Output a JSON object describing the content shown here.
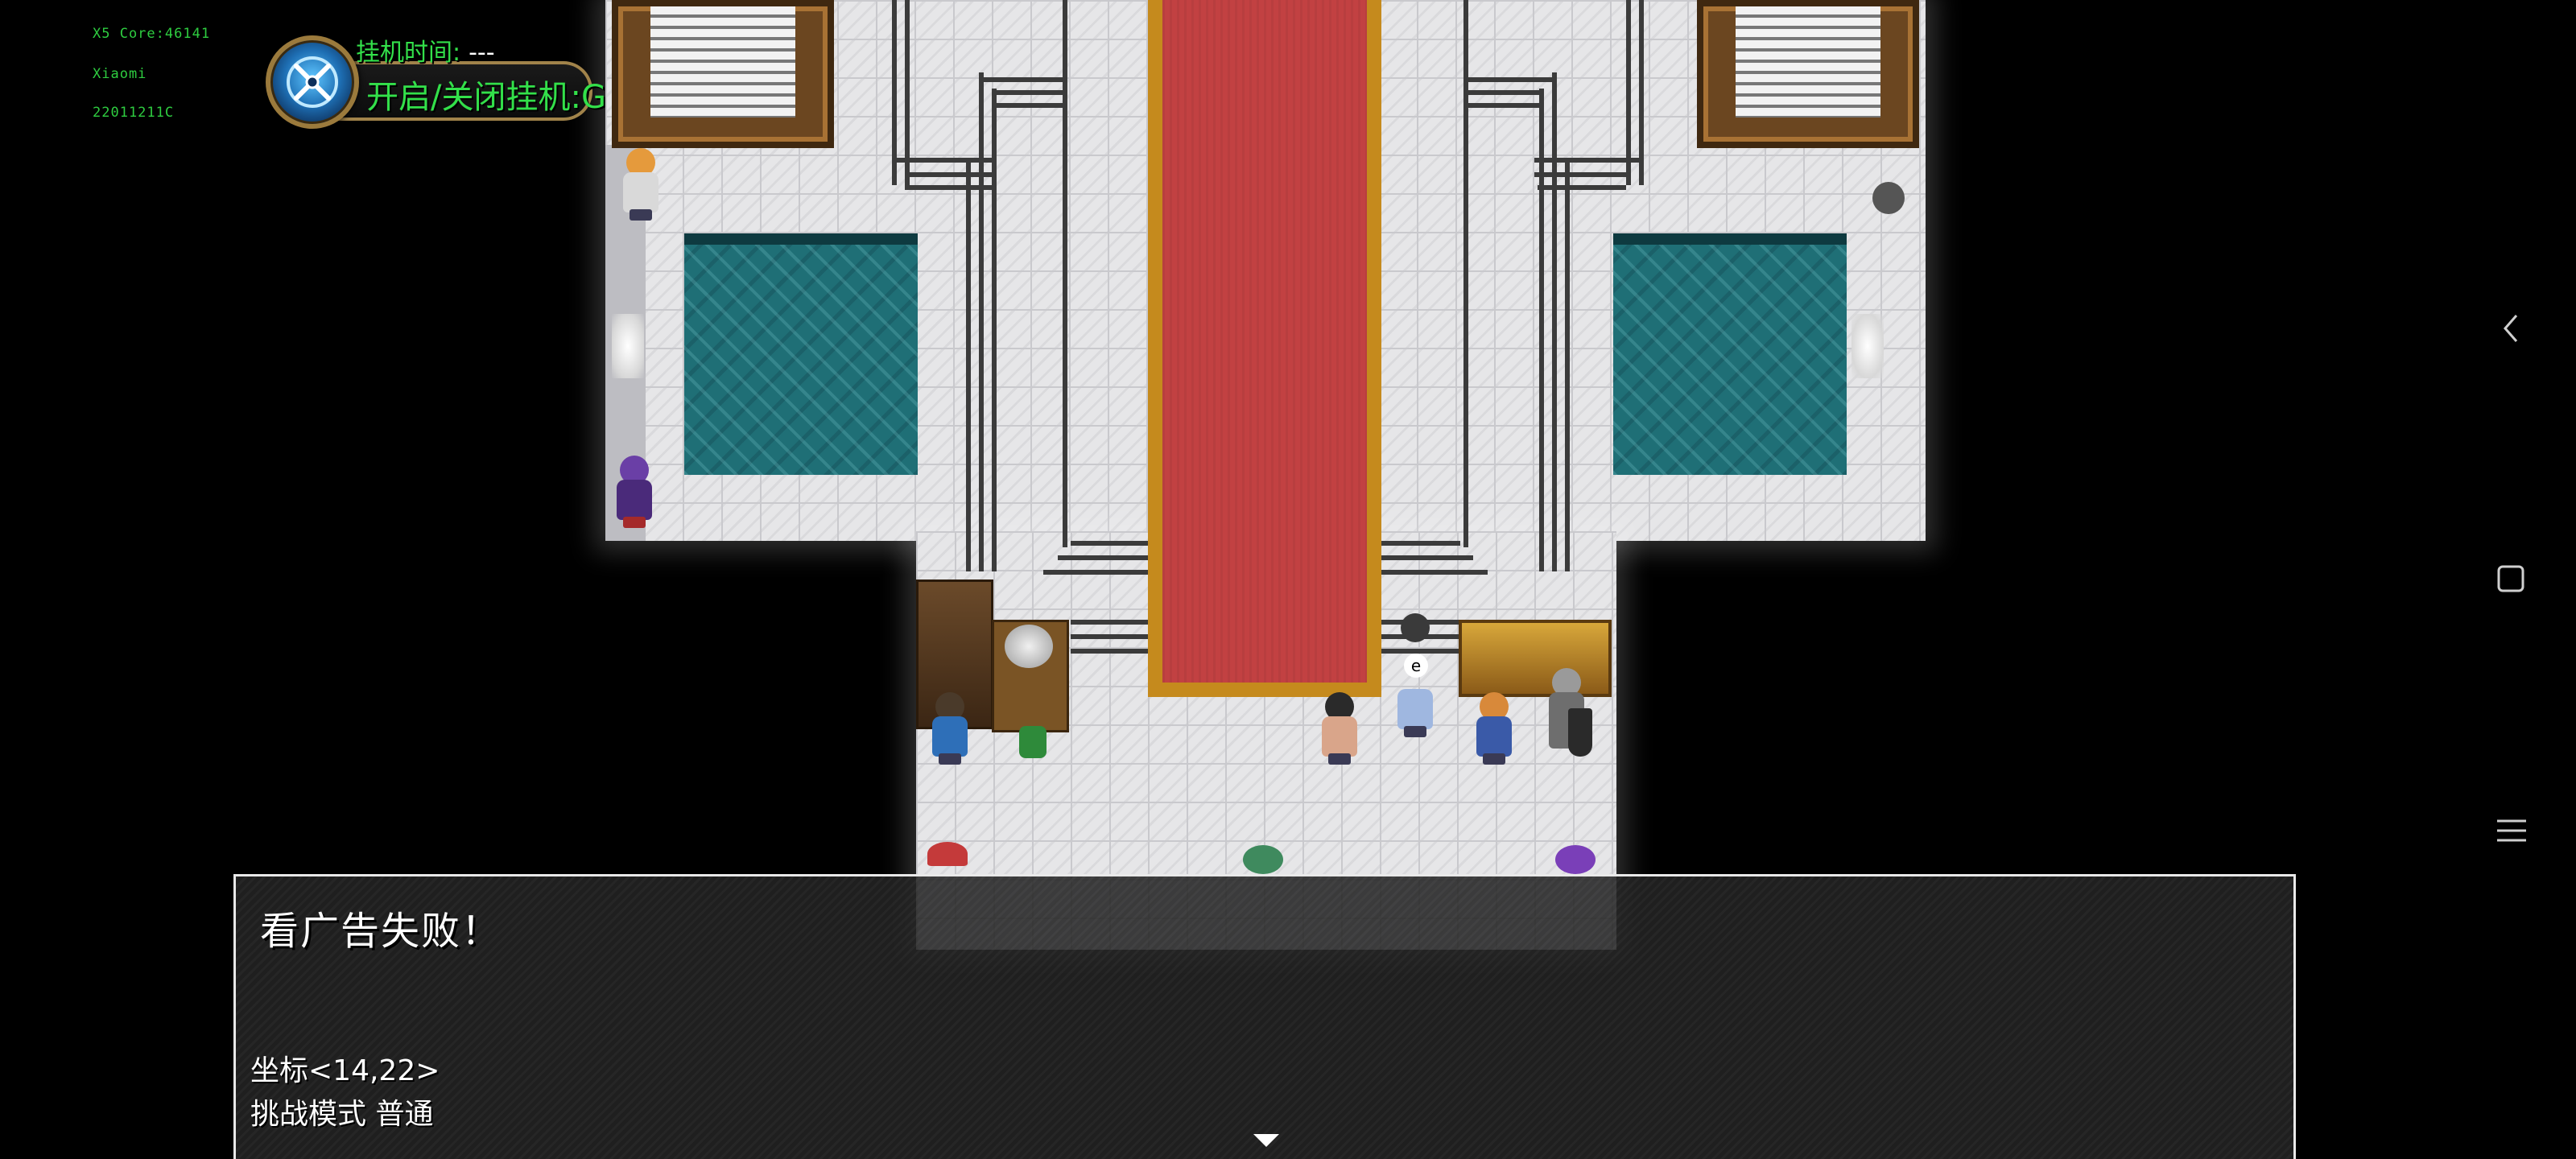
{
  "debug": {
    "core": "X5 Core:46141",
    "brand": "Xiaomi",
    "model": "22011211C"
  },
  "afk": {
    "time_label": "挂机时间:",
    "time_value": "---",
    "toggle_label": "开启/关闭挂机:G",
    "badge_icon": "crossed-swords-icon"
  },
  "dialog": {
    "message": "看广告失败！",
    "coordinates": "坐标<14,22>",
    "mode": "挑战模式 普通",
    "next_icon": "triangle-down-icon"
  },
  "system_nav": {
    "back_icon": "chevron-left-icon",
    "home_icon": "square-icon",
    "menu_icon": "hamburger-menu-icon"
  },
  "colors": {
    "hud_text": "#33e04a",
    "carpet": "#c24142",
    "carpet_border": "#c58a1d",
    "pool": "#1f6f76",
    "floor": "#e6e6e8"
  }
}
